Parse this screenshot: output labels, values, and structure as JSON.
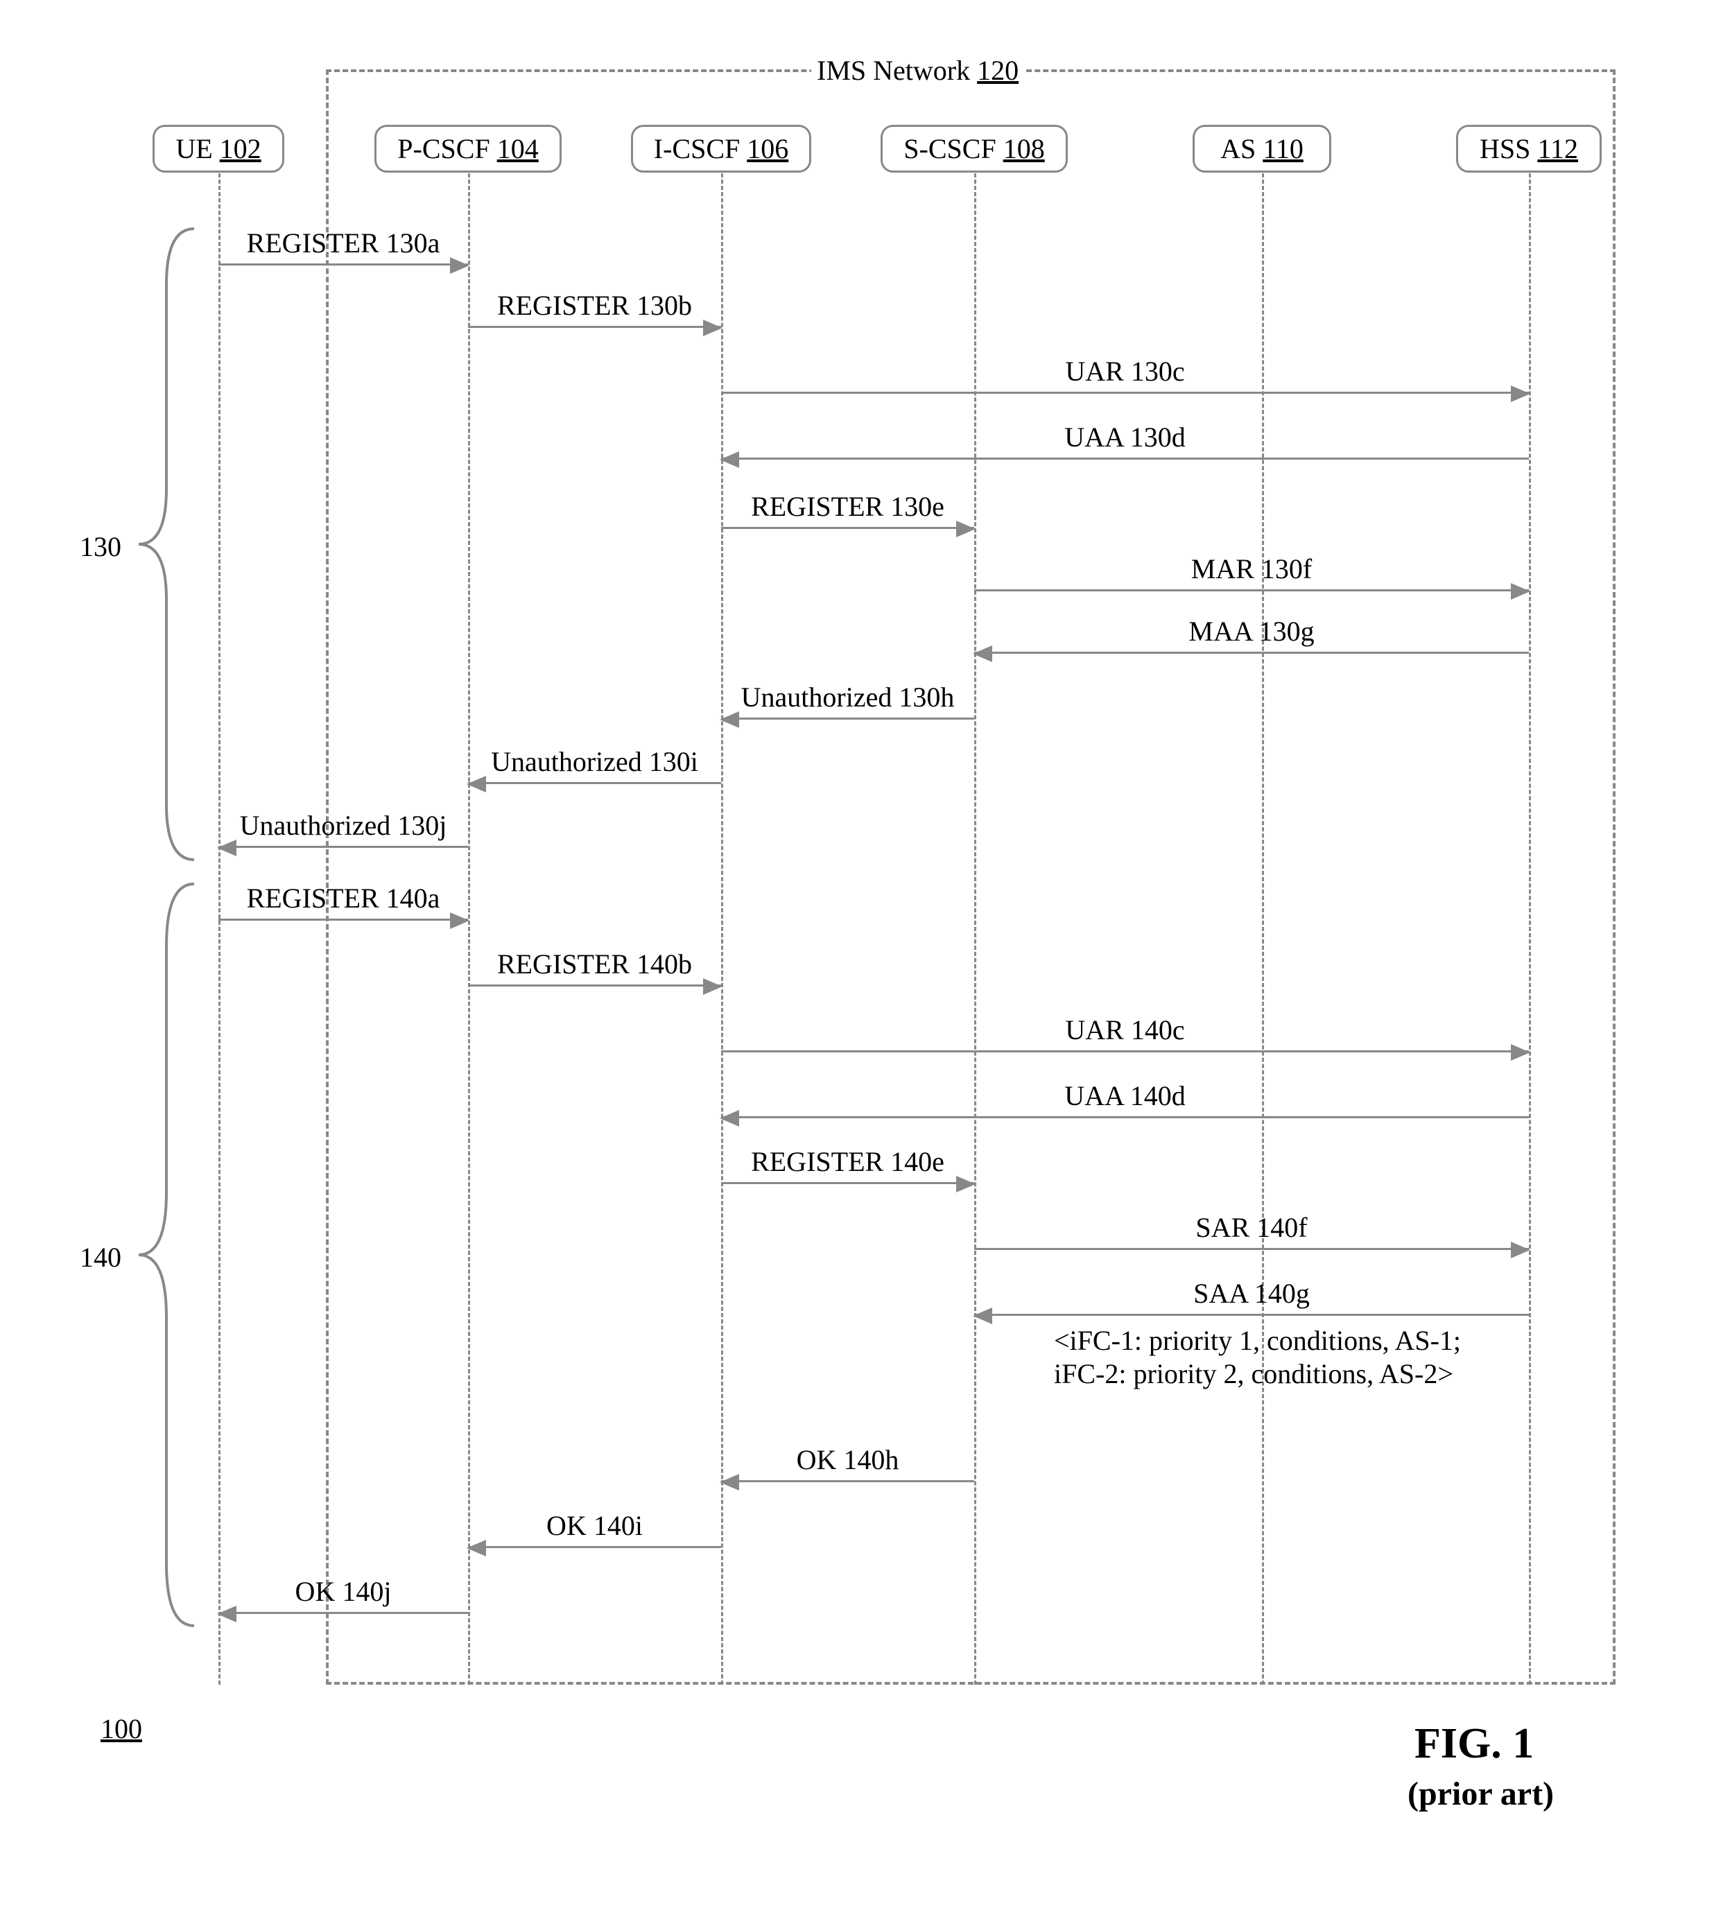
{
  "network": {
    "label": "IMS Network",
    "num": "120"
  },
  "nodes": {
    "ue": {
      "label": "UE",
      "num": "102"
    },
    "pcscf": {
      "label": "P-CSCF",
      "num": "104"
    },
    "icscf": {
      "label": "I-CSCF",
      "num": "106"
    },
    "scscf": {
      "label": "S-CSCF",
      "num": "108"
    },
    "as": {
      "label": "AS",
      "num": "110"
    },
    "hss": {
      "label": "HSS",
      "num": "112"
    }
  },
  "groups": {
    "g130": "130",
    "g140": "140"
  },
  "messages": {
    "m130a": "REGISTER 130a",
    "m130b": "REGISTER 130b",
    "m130c": "UAR 130c",
    "m130d": "UAA 130d",
    "m130e": "REGISTER 130e",
    "m130f": "MAR 130f",
    "m130g": "MAA 130g",
    "m130h": "Unauthorized 130h",
    "m130i": "Unauthorized 130i",
    "m130j": "Unauthorized 130j",
    "m140a": "REGISTER 140a",
    "m140b": "REGISTER 140b",
    "m140c": "UAR 140c",
    "m140d": "UAA 140d",
    "m140e": "REGISTER 140e",
    "m140f": "SAR 140f",
    "m140g": "SAA 140g",
    "m140h": "OK 140h",
    "m140i": "OK 140i",
    "m140j": "OK 140j"
  },
  "ifc": {
    "line1": "<iFC-1: priority 1, conditions, AS-1;",
    "line2": "iFC-2: priority 2, conditions, AS-2>"
  },
  "ref100": "100",
  "figure": {
    "title": "FIG. 1",
    "sub": "(prior art)"
  }
}
